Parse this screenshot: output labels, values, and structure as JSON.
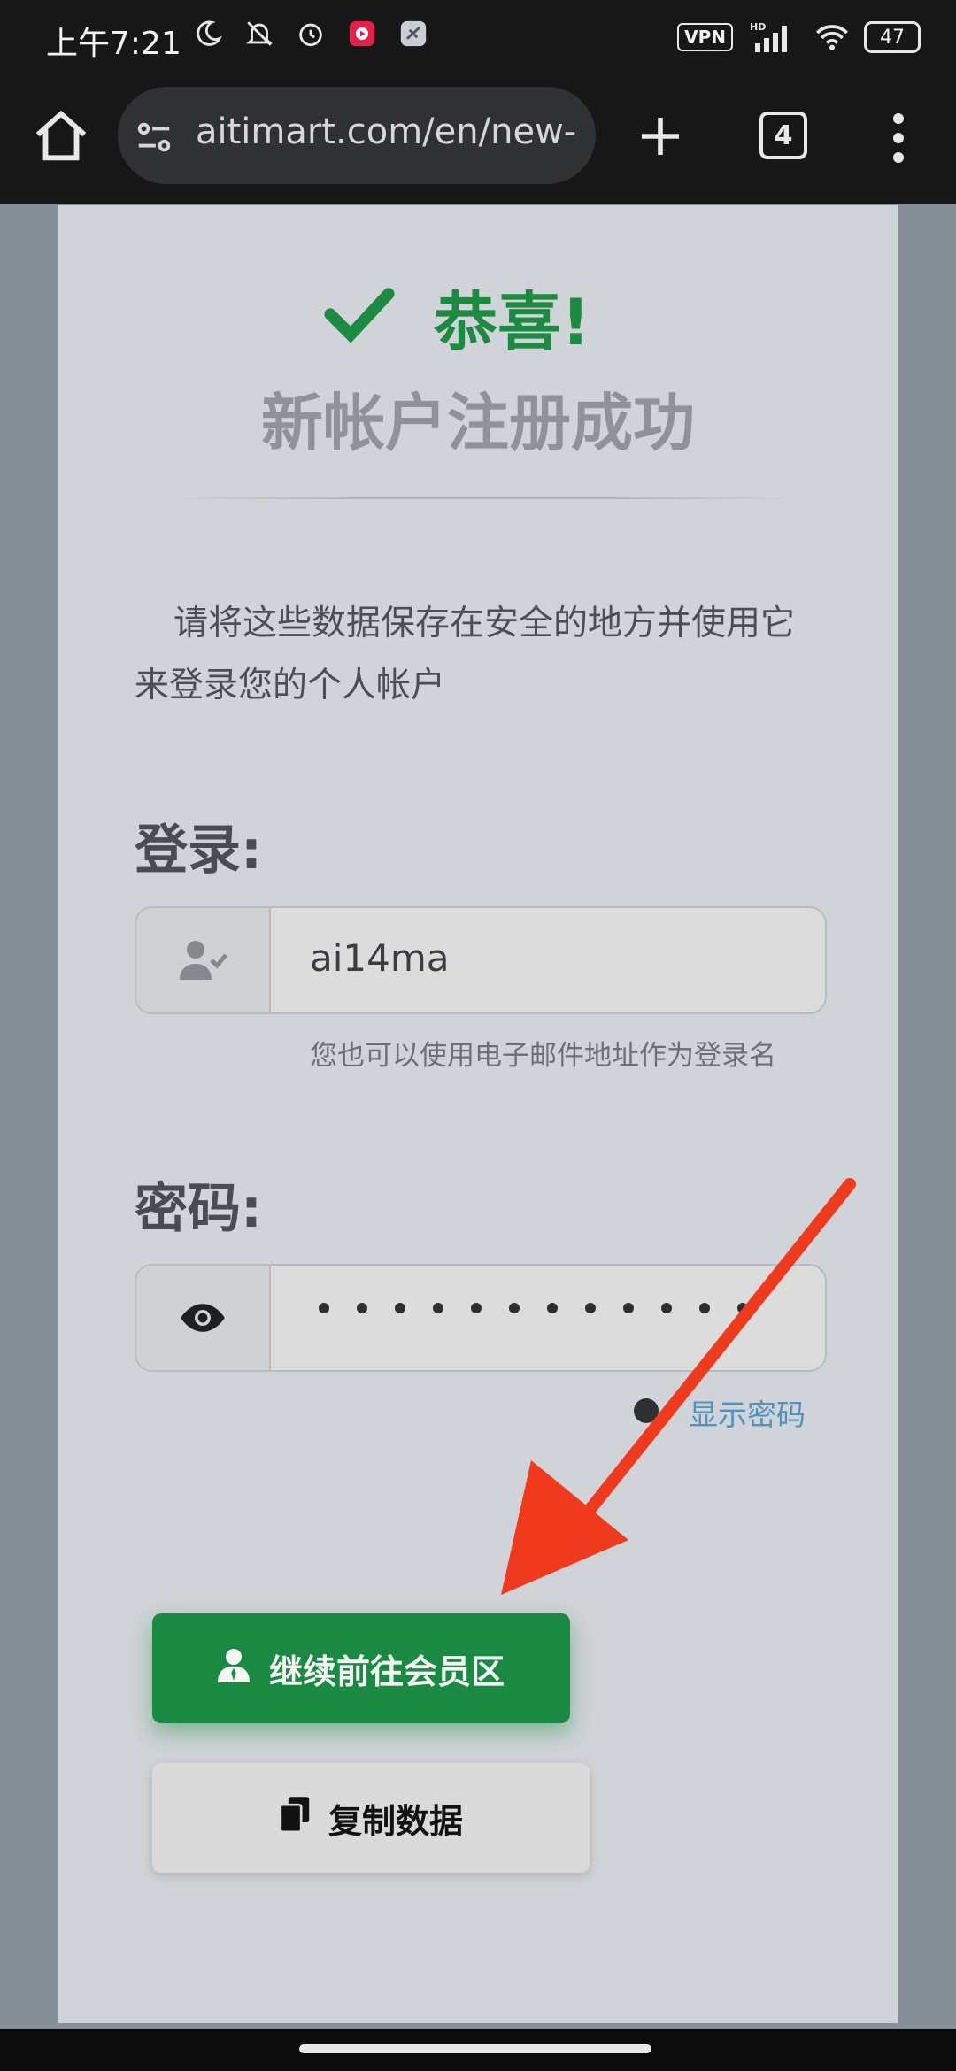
{
  "status_bar": {
    "time": "上午7:21",
    "vpn_label": "VPN",
    "network_label": "HD",
    "battery_level": "47",
    "icons": [
      "moon-icon",
      "bell-off-icon",
      "alarm-icon",
      "app-icon",
      "app-icon-2",
      "signal-icon",
      "wifi-icon",
      "battery-icon"
    ]
  },
  "browser": {
    "url": "aitimart.com/en/new-",
    "tab_count": "4",
    "icons": [
      "home-icon",
      "site-settings-icon",
      "plus-icon",
      "more-vert-icon"
    ]
  },
  "page": {
    "success_title": "恭喜!",
    "success_subtitle": "新帐户注册成功",
    "intro_text": "请将这些数据保存在安全的地方并使用它来登录您的个人帐户",
    "login_label": "登录:",
    "login_value": "ai14ma",
    "login_hint": "您也可以使用电子邮件地址作为登录名",
    "password_label": "密码:",
    "password_masked_length": 12,
    "show_password_label": "显示密码",
    "continue_button": "继续前往会员区",
    "copy_button": "复制数据"
  },
  "colors": {
    "accent_green": "#1a8a43",
    "link_blue": "#4f93bf",
    "annotation_red": "#ef3a1e"
  }
}
